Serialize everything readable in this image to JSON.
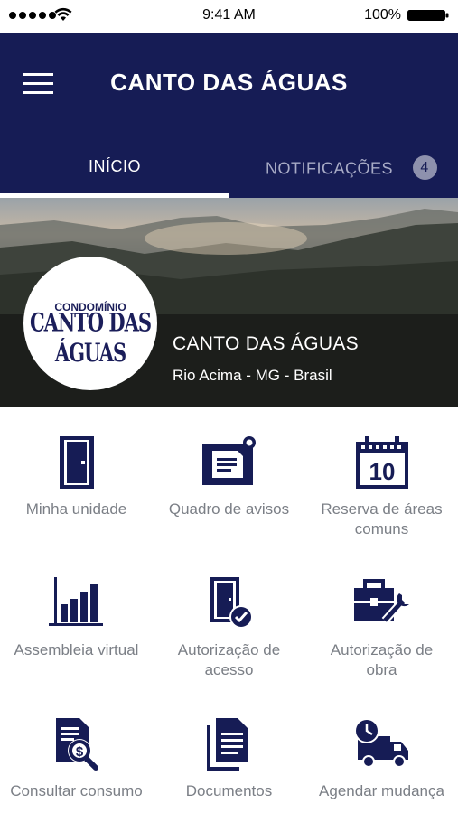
{
  "status_bar": {
    "time": "9:41 AM",
    "battery": "100%"
  },
  "header": {
    "title": "CANTO DAS ÁGUAS",
    "tabs": [
      {
        "label": "INÍCIO",
        "active": true
      },
      {
        "label": "NOTIFICAÇÕES",
        "badge": "4"
      }
    ]
  },
  "banner": {
    "logo_top": "CONDOMÍNIO",
    "logo_main": "CANTO DAS ÁGUAS",
    "name": "CANTO DAS ÁGUAS",
    "location": "Rio Acima - MG - Brasil"
  },
  "colors": {
    "primary": "#161c55",
    "label_gray": "#7b7f86"
  },
  "menu_items": [
    {
      "label": "Minha unidade",
      "icon": "door-icon"
    },
    {
      "label": "Quadro de avisos",
      "icon": "notice-board-icon"
    },
    {
      "label": "Reserva de áreas comuns",
      "icon": "calendar-icon",
      "calendar_day": "10"
    },
    {
      "label": "Assembleia virtual",
      "icon": "bar-chart-icon"
    },
    {
      "label": "Autorização de acesso",
      "icon": "door-check-icon"
    },
    {
      "label": "Autorização de obra",
      "icon": "toolbox-icon"
    },
    {
      "label": "Consultar consumo",
      "icon": "document-money-icon"
    },
    {
      "label": "Documentos",
      "icon": "documents-icon"
    },
    {
      "label": "Agendar mudança",
      "icon": "truck-clock-icon"
    }
  ]
}
